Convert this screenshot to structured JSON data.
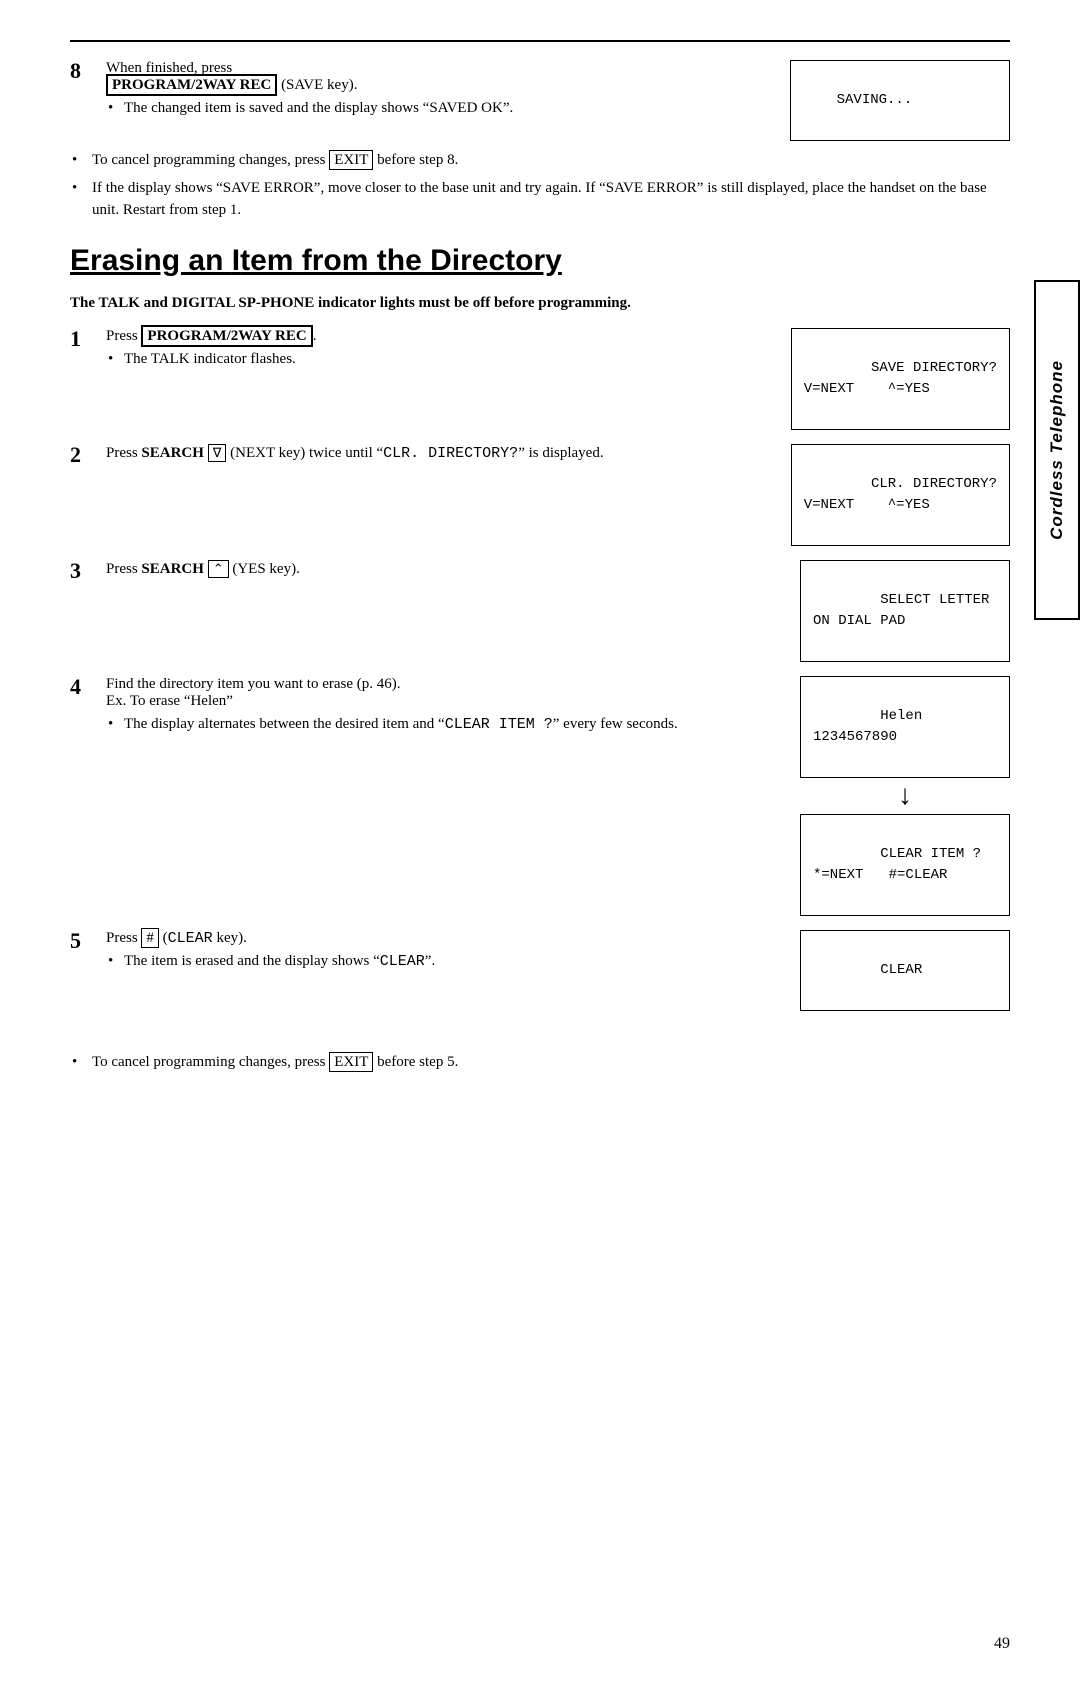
{
  "page": {
    "number": "49"
  },
  "top_section": {
    "step8_number": "8",
    "step8_text": "When finished, press",
    "step8_key": "PROGRAM/2WAY REC",
    "step8_key_suffix": " (SAVE key).",
    "step8_display": "SAVING...",
    "step8_bullet1": "The changed item is saved and the display shows “SAVED OK”.",
    "cancel_note": "To cancel programming changes, press",
    "cancel_key": "EXIT",
    "cancel_suffix": " before step 8.",
    "error_note1": "If the display shows “SAVE ERROR”, move closer to the base unit and try again. If “SAVE ERROR” is still displayed, place the handset on the base unit. Restart from step 1."
  },
  "section": {
    "title_prefix": "rasing an ",
    "title_underline_E": "E",
    "title_underline_I": "I",
    "title_middle": "tem from the ",
    "title_underline_D": "D",
    "title_end": "irectory",
    "title_full": "Erasing an Item from the Directory",
    "prereq": "The TALK and DIGITAL SP-PHONE indicator lights must be off before programming."
  },
  "sidebar": {
    "text": "Cordless Telephone"
  },
  "steps": [
    {
      "number": "1",
      "text": "Press",
      "key": "PROGRAM/2WAY REC",
      "bullet": "The TALK indicator flashes.",
      "display_line1": "SAVE DIRECTORY?",
      "display_line2": "V=NEXT    ^=YES"
    },
    {
      "number": "2",
      "text_pre": "Press ",
      "text_bold": "SEARCH",
      "text_symbol": "∇",
      "text_after": " (NEXT key) twice until “CLR. DIRECTORY?” is displayed.",
      "display_line1": "CLR. DIRECTORY?",
      "display_line2": "V=NEXT    ^=YES"
    },
    {
      "number": "3",
      "text_pre": "Press ",
      "text_bold": "SEARCH",
      "text_symbol": "⌃",
      "text_after": " (YES key).",
      "display_line1": "SELECT LETTER",
      "display_line2": "ON DIAL PAD"
    },
    {
      "number": "4",
      "text": "Find the directory item you want to erase (p. 46).",
      "subtext": "Ex. To erase “Helen”",
      "bullet": "The display alternates between the desired item and “CLEAR ITEM ?” every few seconds.",
      "display_top_line1": "Helen",
      "display_top_line2": "1234567890",
      "display_bottom_line1": "CLEAR ITEM ?",
      "display_bottom_line2": "*=NEXT   #=CLEAR"
    },
    {
      "number": "5",
      "text_pre": "Press ",
      "text_key": "#",
      "text_after": " (CLEAR key).",
      "bullet1": "The item is erased and the display shows “CLEAR”.",
      "display_line1": "CLEAR"
    }
  ],
  "bottom_note": {
    "text": "To cancel programming changes, press",
    "key": "EXIT",
    "suffix": " before step 5."
  }
}
